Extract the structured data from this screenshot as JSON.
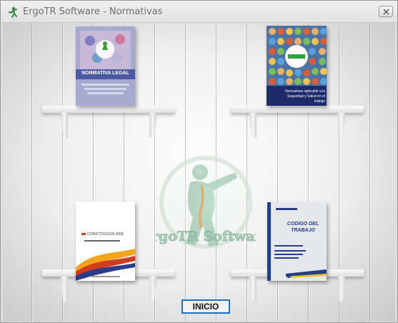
{
  "window": {
    "title": "ErgoTR Software - Normativas",
    "icon": "figure-icon"
  },
  "books": [
    {
      "name": "book-normativa-legal",
      "title": "NORMATIVA LEGAL",
      "colors": {
        "bg": "#8a8fb8",
        "band": "#4f58a6",
        "accent": "#3a9a3a"
      }
    },
    {
      "name": "book-normativas-sst",
      "title": "Normativas aplicable a la Seguridad y Salud en el trabajo",
      "colors": {
        "bg": "#1d2b6a",
        "accent": "#2aa33c"
      }
    },
    {
      "name": "book-constitucion",
      "title": "CONSTITUCION 2008",
      "colors": {
        "bg": "#ffffff",
        "swoosh1": "#f2a51c",
        "swoosh2": "#d13c1f",
        "swoosh3": "#2a3d8a"
      }
    },
    {
      "name": "book-codigo-trabajo",
      "title": "CODIGO DEL TRABAJO",
      "colors": {
        "bg": "#e6e7ea",
        "stripe": "#233f8c"
      }
    }
  ],
  "watermark": {
    "text": "ErgoTR Software"
  },
  "buttons": {
    "inicio": "INICIO"
  }
}
